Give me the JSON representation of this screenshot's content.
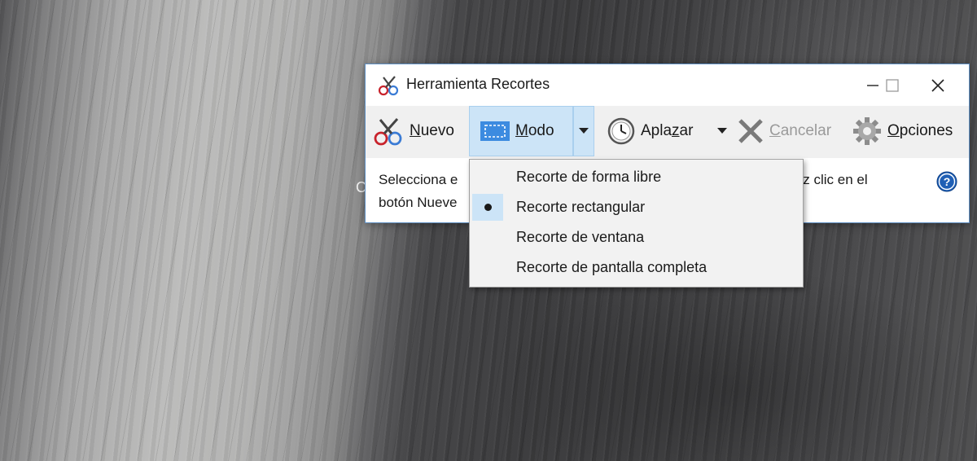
{
  "window": {
    "title": "Herramienta Recortes",
    "controls": {
      "minimize": "minimize-icon",
      "maximize": "maximize-icon",
      "close": "close-icon"
    }
  },
  "toolbar": {
    "new_label_u": "N",
    "new_label_rest": "uevo",
    "mode_label_u": "M",
    "mode_label_rest": "odo",
    "delay_label_pre": "Apla",
    "delay_label_u": "z",
    "delay_label_post": "ar",
    "cancel_label_u": "C",
    "cancel_label_rest": "ancelar",
    "options_label_u": "O",
    "options_label_rest": "pciones"
  },
  "hint": {
    "line1_start": "Selecciona e",
    "line1_end": "haz clic en el",
    "line2_start": "botón Nueve"
  },
  "background_partial_char": "C",
  "mode_menu": {
    "items": [
      {
        "label": "Recorte de forma libre",
        "selected": false
      },
      {
        "label": "Recorte rectangular",
        "selected": true
      },
      {
        "label": "Recorte de ventana",
        "selected": false
      },
      {
        "label": "Recorte de pantalla completa",
        "selected": false
      }
    ]
  },
  "colors": {
    "accent_hover": "#cce4f7",
    "toolbar_bg": "#f0f0f0",
    "help_icon": "#1f5fb5"
  }
}
